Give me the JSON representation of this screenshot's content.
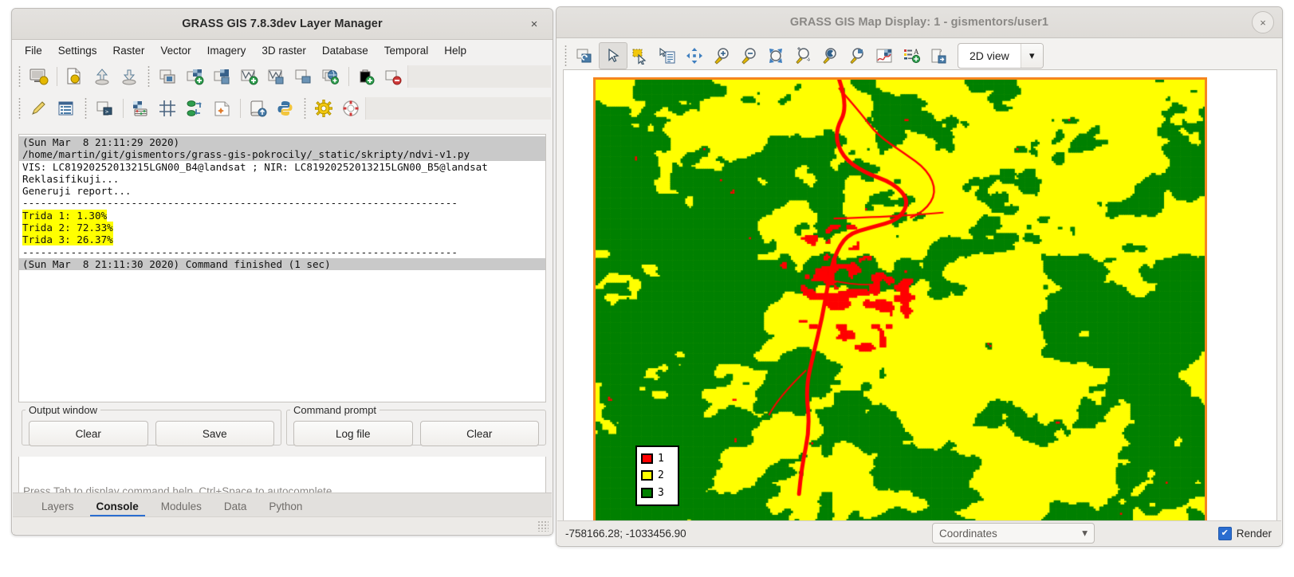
{
  "layer_manager": {
    "title": "GRASS GIS 7.8.3dev Layer Manager",
    "close_label": "×",
    "menus": [
      "File",
      "Settings",
      "Raster",
      "Vector",
      "Imagery",
      "3D raster",
      "Database",
      "Temporal",
      "Help"
    ],
    "toolbar_row1": [
      {
        "name": "start-new-workspace-icon",
        "glyph": "🖥"
      },
      {
        "name": "open-workspace-icon",
        "glyph": "📄"
      },
      {
        "name": "load-workspace-icon",
        "glyph": "⬆"
      },
      {
        "name": "save-workspace-icon",
        "glyph": "⬇"
      },
      {
        "name": "add-raster-map-layer-icon",
        "glyph": "▣"
      },
      {
        "name": "add-various-raster-layers-icon",
        "glyph": "▦"
      },
      {
        "name": "add-raster-group-icon",
        "glyph": "▧"
      },
      {
        "name": "add-vector-map-layer-icon",
        "glyph": "⋁"
      },
      {
        "name": "add-various-vector-layers-icon",
        "glyph": "⋀"
      },
      {
        "name": "add-overlay-icon",
        "glyph": "▭"
      },
      {
        "name": "add-web-service-layer-icon",
        "glyph": "🌐"
      },
      {
        "name": "add-group-icon",
        "glyph": "📁"
      },
      {
        "name": "remove-layer-icon",
        "glyph": "⊖"
      }
    ],
    "toolbar_row2": [
      {
        "name": "edit-vector-map-icon",
        "glyph": "✎"
      },
      {
        "name": "show-attribute-table-icon",
        "glyph": "☰"
      },
      {
        "name": "add-command-layer-icon",
        "glyph": "▮"
      },
      {
        "name": "raster-map-calculator-icon",
        "glyph": "🧮"
      },
      {
        "name": "georectifier-icon",
        "glyph": "⌗"
      },
      {
        "name": "vector-network-analysis-icon",
        "glyph": "⇄"
      },
      {
        "name": "cartographic-composer-icon",
        "glyph": "✡"
      },
      {
        "name": "launch-script-icon",
        "glyph": "📜"
      },
      {
        "name": "python-shell-icon",
        "glyph": "🐍"
      },
      {
        "name": "settings-icon",
        "glyph": "⚙"
      },
      {
        "name": "help-icon",
        "glyph": "⊕"
      }
    ],
    "console_lines": [
      {
        "text": "(Sun Mar  8 21:11:29 2020)",
        "style": "cmd"
      },
      {
        "text": "/home/martin/git/gismentors/grass-gis-pokrocily/_static/skripty/ndvi-v1.py",
        "style": "cmd"
      },
      {
        "text": "VIS: LC81920252013215LGN00_B4@landsat ; NIR: LC81920252013215LGN00_B5@landsat",
        "style": "plain"
      },
      {
        "text": "Reklasifikuji...",
        "style": "plain"
      },
      {
        "text": "Generuji report...",
        "style": "plain"
      },
      {
        "text": "------------------------------------------------------------------------",
        "style": "plain"
      },
      {
        "text": "Trida 1: 1.30%",
        "style": "highlight"
      },
      {
        "text": "Trida 2: 72.33%",
        "style": "highlight"
      },
      {
        "text": "Trida 3: 26.37%",
        "style": "highlight"
      },
      {
        "text": "------------------------------------------------------------------------",
        "style": "plain"
      },
      {
        "text": "(Sun Mar  8 21:11:30 2020) Command finished (1 sec)",
        "style": "cmd"
      }
    ],
    "output_window": {
      "legend": "Output window",
      "clear_label": "Clear",
      "save_label": "Save"
    },
    "command_prompt": {
      "legend": "Command prompt",
      "logfile_label": "Log file",
      "clear_label": "Clear",
      "input_value": "",
      "hint": "Press Tab to display command help, Ctrl+Space to autocomplete"
    },
    "tabs": [
      {
        "label": "Layers",
        "active": false
      },
      {
        "label": "Console",
        "active": true
      },
      {
        "label": "Modules",
        "active": false
      },
      {
        "label": "Data",
        "active": false
      },
      {
        "label": "Python",
        "active": false
      }
    ]
  },
  "map_display": {
    "title": "GRASS GIS Map Display: 1 - gismentors/user1",
    "close_label": "×",
    "toolbar": [
      {
        "name": "render-map-icon",
        "glyph": "⟳"
      },
      {
        "name": "pointer-icon",
        "glyph": "➤",
        "selected": true
      },
      {
        "name": "select-region-icon",
        "glyph": "▭"
      },
      {
        "name": "query-raster-vector-icon",
        "glyph": "📋"
      },
      {
        "name": "pan-icon",
        "glyph": "✥"
      },
      {
        "name": "zoom-in-icon",
        "glyph": "⊕"
      },
      {
        "name": "zoom-out-icon",
        "glyph": "⊖"
      },
      {
        "name": "zoom-to-extent-icon",
        "glyph": "⤡"
      },
      {
        "name": "zoom-options-icon",
        "glyph": "⌕"
      },
      {
        "name": "zoom-back-icon",
        "glyph": "↩"
      },
      {
        "name": "zoom-save-icon",
        "glyph": "↪"
      },
      {
        "name": "analyze-map-icon",
        "glyph": "📈"
      },
      {
        "name": "add-map-elements-icon",
        "glyph": "🗚"
      },
      {
        "name": "save-display-to-file-icon",
        "glyph": "💾"
      }
    ],
    "view_mode": {
      "label": "2D view",
      "arrow": "▾"
    },
    "legend": {
      "entries": [
        {
          "value": "1",
          "color": "#ff0000"
        },
        {
          "value": "2",
          "color": "#ffff00"
        },
        {
          "value": "3",
          "color": "#008000"
        }
      ]
    },
    "status": {
      "coordinates": "-758166.28; -1033456.90",
      "mode_label": "Coordinates",
      "mode_arrow": "▾",
      "render_label": "Render",
      "render_checked": true,
      "check_glyph": "✔"
    },
    "colors": {
      "class1": "#ff0000",
      "class2": "#ffff00",
      "class3": "#008000",
      "map_border": "#f5861f"
    }
  }
}
